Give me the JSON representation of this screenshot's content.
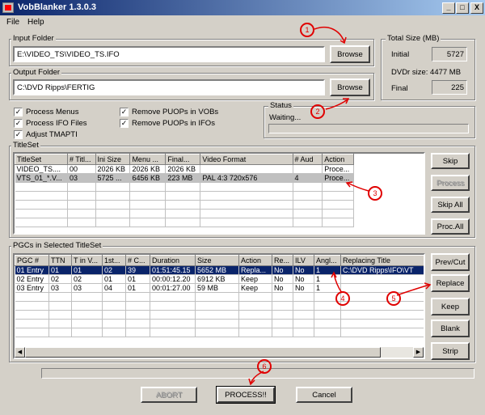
{
  "window": {
    "title": "VobBlanker 1.3.0.3",
    "controls": [
      "_",
      "□",
      "X"
    ]
  },
  "menu": [
    "File",
    "Help"
  ],
  "input_folder": {
    "label": "Input Folder",
    "value": "E:\\VIDEO_TS\\VIDEO_TS.IFO",
    "browse": "Browse"
  },
  "output_folder": {
    "label": "Output Folder",
    "value": "C:\\DVD Ripps\\FERTIG",
    "browse": "Browse"
  },
  "total_size": {
    "label": "Total Size (MB)",
    "initial_label": "Initial",
    "initial_value": "5727",
    "dvdr_label": "DVDr size: 4477 MB",
    "final_label": "Final",
    "final_value": "225"
  },
  "options": [
    {
      "label": "Process Menus",
      "checked": true
    },
    {
      "label": "Process IFO Files",
      "checked": true
    },
    {
      "label": "Adjust TMAPTI",
      "checked": true
    },
    {
      "label": "Remove PUOPs in VOBs",
      "checked": true
    },
    {
      "label": "Remove PUOPs in IFOs",
      "checked": true
    }
  ],
  "status": {
    "label": "Status",
    "text": "Waiting...",
    "progress": 0
  },
  "titleset": {
    "label": "TitleSet",
    "columns": [
      "TitleSet",
      "# Titl...",
      "Ini Size",
      "Menu ...",
      "Final...",
      "Video Format",
      "# Aud",
      "Action"
    ],
    "rows": [
      [
        "VIDEO_TS....",
        "00",
        "2026 KB",
        "2026 KB",
        "2026 KB",
        "",
        "",
        "Proce..."
      ],
      [
        "VTS_01_*.V...",
        "03",
        "5725 ...",
        "6456 KB",
        "223 MB",
        "PAL   4:3 720x576",
        "4",
        "Proce..."
      ]
    ],
    "buttons": {
      "skip": "Skip",
      "process": "Process",
      "skip_all": "Skip All",
      "proc_all": "Proc.All"
    }
  },
  "pgcs": {
    "label": "PGCs in Selected TitleSet",
    "columns": [
      "PGC #",
      "TTN",
      "T in V...",
      "1st...",
      "# C...",
      "Duration",
      "Size",
      "Action",
      "Re...",
      "ILV",
      "Angl...",
      "Replacing Title"
    ],
    "rows": [
      [
        "01 Entry",
        "01",
        "01",
        "02",
        "39",
        "01:51:45.15",
        "5652 MB",
        "Repla...",
        "No",
        "No",
        "1",
        "C:\\DVD Ripps\\IFO\\VT"
      ],
      [
        "02 Entry",
        "02",
        "02",
        "01",
        "01",
        "00:00:12.20",
        "6912 KB",
        "Keep",
        "No",
        "No",
        "1",
        ""
      ],
      [
        "03 Entry",
        "03",
        "03",
        "04",
        "01",
        "00:01:27.00",
        "59 MB",
        "Keep",
        "No",
        "No",
        "1",
        ""
      ]
    ],
    "buttons": {
      "prev_cut": "Prev/Cut",
      "replace": "Replace",
      "keep": "Keep",
      "blank": "Blank",
      "strip": "Strip"
    }
  },
  "bottom": {
    "abort": "ABORT",
    "process": "PROCESS!!",
    "cancel": "Cancel"
  },
  "annotations": [
    "1",
    "2",
    "3",
    "4",
    "5",
    "6"
  ],
  "colors": {
    "annotation": "#e00000",
    "selection": "#0a246a",
    "titlebar": "#0a246a"
  }
}
